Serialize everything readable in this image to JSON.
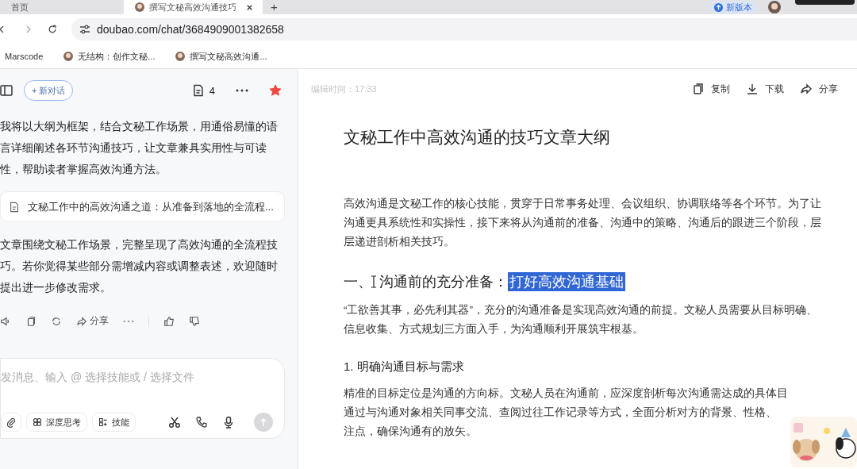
{
  "browser": {
    "tabs": [
      {
        "label": "首页",
        "selected": false,
        "closable": false
      },
      {
        "label": "撰写文秘高效沟通技巧",
        "selected": true,
        "closable": true
      }
    ],
    "new_tab": "+",
    "update_button": "新版本",
    "url": "doubao.com/chat/3684909001382658",
    "bookmarks": [
      {
        "label": "Marscode",
        "favicon": false
      },
      {
        "label": "无结构：创作文秘...",
        "favicon": true
      },
      {
        "label": "撰写文秘高效沟通...",
        "favicon": true
      }
    ]
  },
  "chat": {
    "new_chat": "+ 新对话",
    "doc_count": "4",
    "starred": true,
    "messages": [
      {
        "kind": "text",
        "text": "我将以大纲为框架，结合文秘工作场景，用通俗易懂的语言详细阐述各环节沟通技巧，让文章兼具实用性与可读性，帮助读者掌握高效沟通方法。"
      },
      {
        "kind": "doc",
        "text": "文秘工作中的高效沟通之道：从准备到落地的全流程..."
      },
      {
        "kind": "text",
        "text": "文章围绕文秘工作场景，完整呈现了高效沟通的全流程技巧。若你觉得某些部分需增减内容或调整表述，欢迎随时提出进一步修改需求。"
      }
    ],
    "share": "分享",
    "input": {
      "placeholder": "发消息、输入 @ 选择技能或 / 选择文件",
      "chips": [
        "深度思考",
        "技能"
      ]
    }
  },
  "document": {
    "edit_time": "编辑时间：17:33",
    "actions": [
      {
        "kind": "copy",
        "label": "复制"
      },
      {
        "kind": "download",
        "label": "下载"
      },
      {
        "kind": "share",
        "label": "分享"
      }
    ],
    "title": "文秘工作中高效沟通的技巧文章大纲",
    "blocks": [
      {
        "kind": "paragraph",
        "lines": [
          "高效沟通是文秘工作的核心技能，贯穿于日常事务处理、会议组织、协调联络等各个环节。为了让",
          "沟通更具系统性和实操性，接下来将从沟通前的准备、沟通中的策略、沟通后的跟进三个阶段，层",
          "层递进剖析相关技巧。"
        ]
      },
      {
        "kind": "heading",
        "parts": [
          {
            "text": "一、",
            "selected": false
          },
          {
            "text": "沟通前的充分准备：",
            "selected": false
          },
          {
            "text": "打好高效沟通基础",
            "selected": true
          }
        ]
      },
      {
        "kind": "paragraph",
        "lines": [
          "“工欲善其事，必先利其器”，充分的沟通准备是实现高效沟通的前提。文秘人员需要从目标明确、",
          "信息收集、方式规划三方面入手，为沟通顺利开展筑牢根基。"
        ]
      },
      {
        "kind": "subheading",
        "parts": [
          {
            "text": "1. 明确沟通目标与需求",
            "selected": false
          }
        ]
      },
      {
        "kind": "paragraph",
        "lines": [
          "精准的目标定位是沟通的方向标。文秘人员在沟通前，应深度剖析每次沟通需达成的具体目",
          "通过与沟通对象相关同事交流、查阅过往工作记录等方式，全面分析对方的背景、性格、",
          "注点，确保沟通有的放矢。"
        ]
      }
    ]
  }
}
